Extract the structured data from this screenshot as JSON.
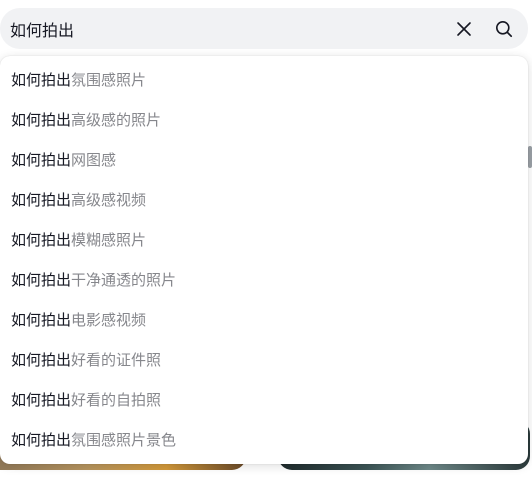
{
  "search": {
    "value": "如何拍出",
    "clear_icon": "close-icon",
    "search_icon": "search-icon"
  },
  "colors": {
    "caret": "#fe2c55",
    "query_text": "#161823",
    "suggestion_suffix": "#86878c",
    "search_bg": "#f1f2f4"
  },
  "suggestions": [
    {
      "prefix": "如何拍出",
      "suffix": "氛围感照片"
    },
    {
      "prefix": "如何拍出",
      "suffix": "高级感的照片"
    },
    {
      "prefix": "如何拍出",
      "suffix": "网图感"
    },
    {
      "prefix": "如何拍出",
      "suffix": "高级感视频"
    },
    {
      "prefix": "如何拍出",
      "suffix": "模糊感照片"
    },
    {
      "prefix": "如何拍出",
      "suffix": "干净通透的照片"
    },
    {
      "prefix": "如何拍出",
      "suffix": "电影感视频"
    },
    {
      "prefix": "如何拍出",
      "suffix": "好看的证件照"
    },
    {
      "prefix": "如何拍出",
      "suffix": "好看的自拍照"
    },
    {
      "prefix": "如何拍出",
      "suffix": "氛围感照片景色"
    }
  ]
}
